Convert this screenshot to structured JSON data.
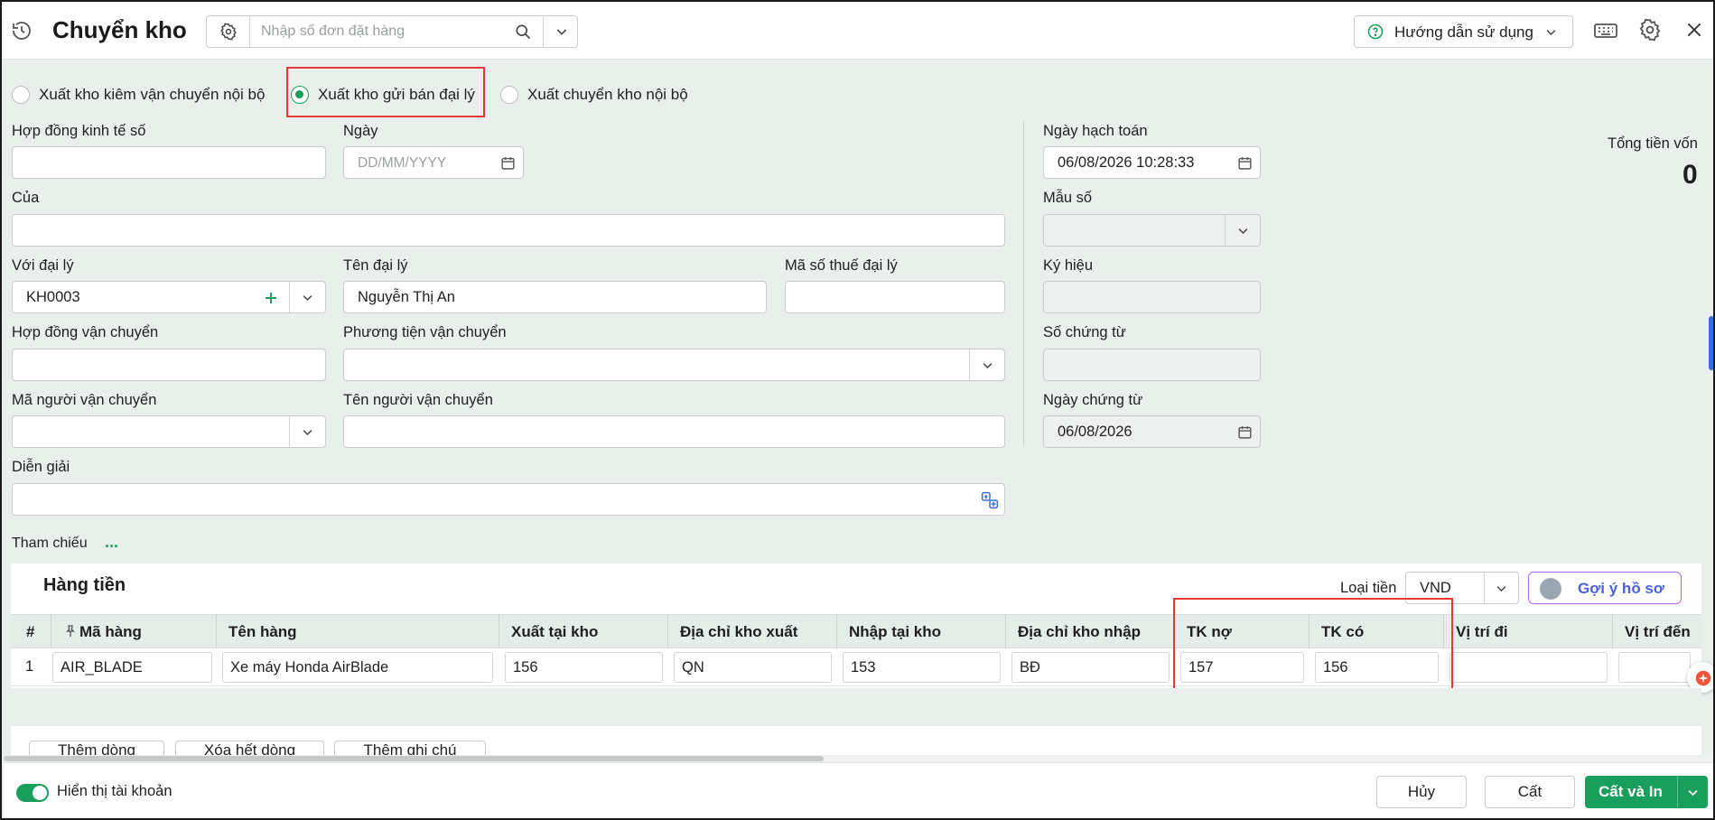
{
  "header": {
    "title": "Chuyển kho",
    "search_placeholder": "Nhập số đơn đặt hàng",
    "help_label": "Hướng dẫn sử dụng"
  },
  "export_types": [
    {
      "label": "Xuất kho kiêm vận chuyển nội bộ",
      "selected": false
    },
    {
      "label": "Xuất kho gửi bán đại lý",
      "selected": true
    },
    {
      "label": "Xuất chuyển kho nội bộ",
      "selected": false
    }
  ],
  "form": {
    "contract_no_label": "Hợp đồng kinh tế số",
    "date_label": "Ngày",
    "date_placeholder": "DD/MM/YYYY",
    "of_label": "Của",
    "agent_label": "Với đại lý",
    "agent_value": "KH0003",
    "agent_name_label": "Tên đại lý",
    "agent_name_value": "Nguyễn Thị An",
    "agent_tax_label": "Mã số thuế đại lý",
    "transport_contract_label": "Hợp đồng vận chuyển",
    "vehicle_label": "Phương tiện vận chuyển",
    "carrier_code_label": "Mã người vận chuyển",
    "carrier_name_label": "Tên người vận chuyển",
    "description_label": "Diễn giải",
    "reference_label": "Tham chiếu",
    "reference_more": "..."
  },
  "side": {
    "posting_date_label": "Ngày hạch toán",
    "posting_date_value": "06/08/2026 10:28:33",
    "template_label": "Mẫu số",
    "symbol_label": "Ký hiệu",
    "voucher_no_label": "Số chứng từ",
    "voucher_date_label": "Ngày chứng từ",
    "voucher_date_value": "06/08/2026",
    "total_label": "Tổng tiền vốn",
    "total_value": "0"
  },
  "goods": {
    "section_title": "Hàng tiền",
    "currency_label": "Loại tiền",
    "currency_value": "VND",
    "suggest_label": "Gợi ý hồ sơ",
    "columns": [
      "#",
      "Mã hàng",
      "Tên hàng",
      "Xuất tại kho",
      "Địa chỉ kho xuất",
      "Nhập tại kho",
      "Địa chỉ kho nhập",
      "TK nợ",
      "TK có",
      "Vị trí đi",
      "Vị trí đến"
    ],
    "rows": [
      {
        "no": "1",
        "code": "AIR_BLADE",
        "name": "Xe máy Honda AirBlade",
        "from_wh": "156",
        "from_addr": "QN",
        "to_wh": "153",
        "to_addr": "BĐ",
        "debit": "157",
        "credit": "156",
        "from_pos": "",
        "to_pos": ""
      }
    ],
    "add_row": "Thêm dòng",
    "delete_all": "Xóa hết dòng",
    "add_note": "Thêm ghi chú"
  },
  "footer": {
    "show_account_label": "Hiển thị tài khoản",
    "show_account_on": true,
    "cancel": "Hủy",
    "save": "Cất",
    "save_print": "Cất và In"
  },
  "colors": {
    "accent": "#1a9e5c",
    "highlight": "#e53935",
    "background": "#e9f0ec"
  }
}
